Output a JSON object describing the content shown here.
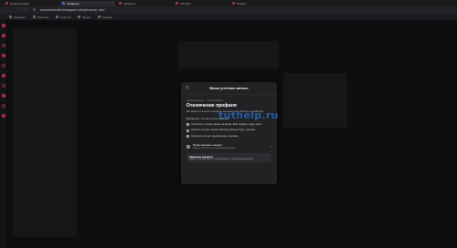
{
  "tabs": [
    {
      "label": "Новая вкладка",
      "active": false
    },
    {
      "label": "Instagram",
      "active": true
    },
    {
      "label": "Facebook",
      "active": false
    },
    {
      "label": "YouTube",
      "active": false
    },
    {
      "label": "Яндекс",
      "active": false
    }
  ],
  "address": {
    "url": "accountscenter.instagram.com/personal_info/"
  },
  "bookmarks": [
    "Закладки",
    "Рабочие",
    "Новости",
    "Видео",
    "Музыка"
  ],
  "modal": {
    "header_title": "Ваша учетная запись",
    "back_icon": "back-arrow-icon",
    "breadcrumb": "Личные данные · Учетная запись",
    "title": "Отключение профиля",
    "description": "Вы можете отключить профиль на время или удалить его навсегда.",
    "options_title": "Выберите, что вы хотите сделать",
    "options": [
      "Отключить учетную запись на время. Ваш профиль будет скрыт.",
      "Удалить учетную запись навсегда. Данные будут удалены.",
      "Отключить только уведомления и рекламу."
    ],
    "row_title": "Приостановить аккаунт",
    "row_sub": "Скрыть профиль на определённое время",
    "note_title": "Удаление аккаунта",
    "note_sub": "Удалить учётную запись и все связанные с ней данные навсегда."
  },
  "watermark": "tuthelp.ru"
}
